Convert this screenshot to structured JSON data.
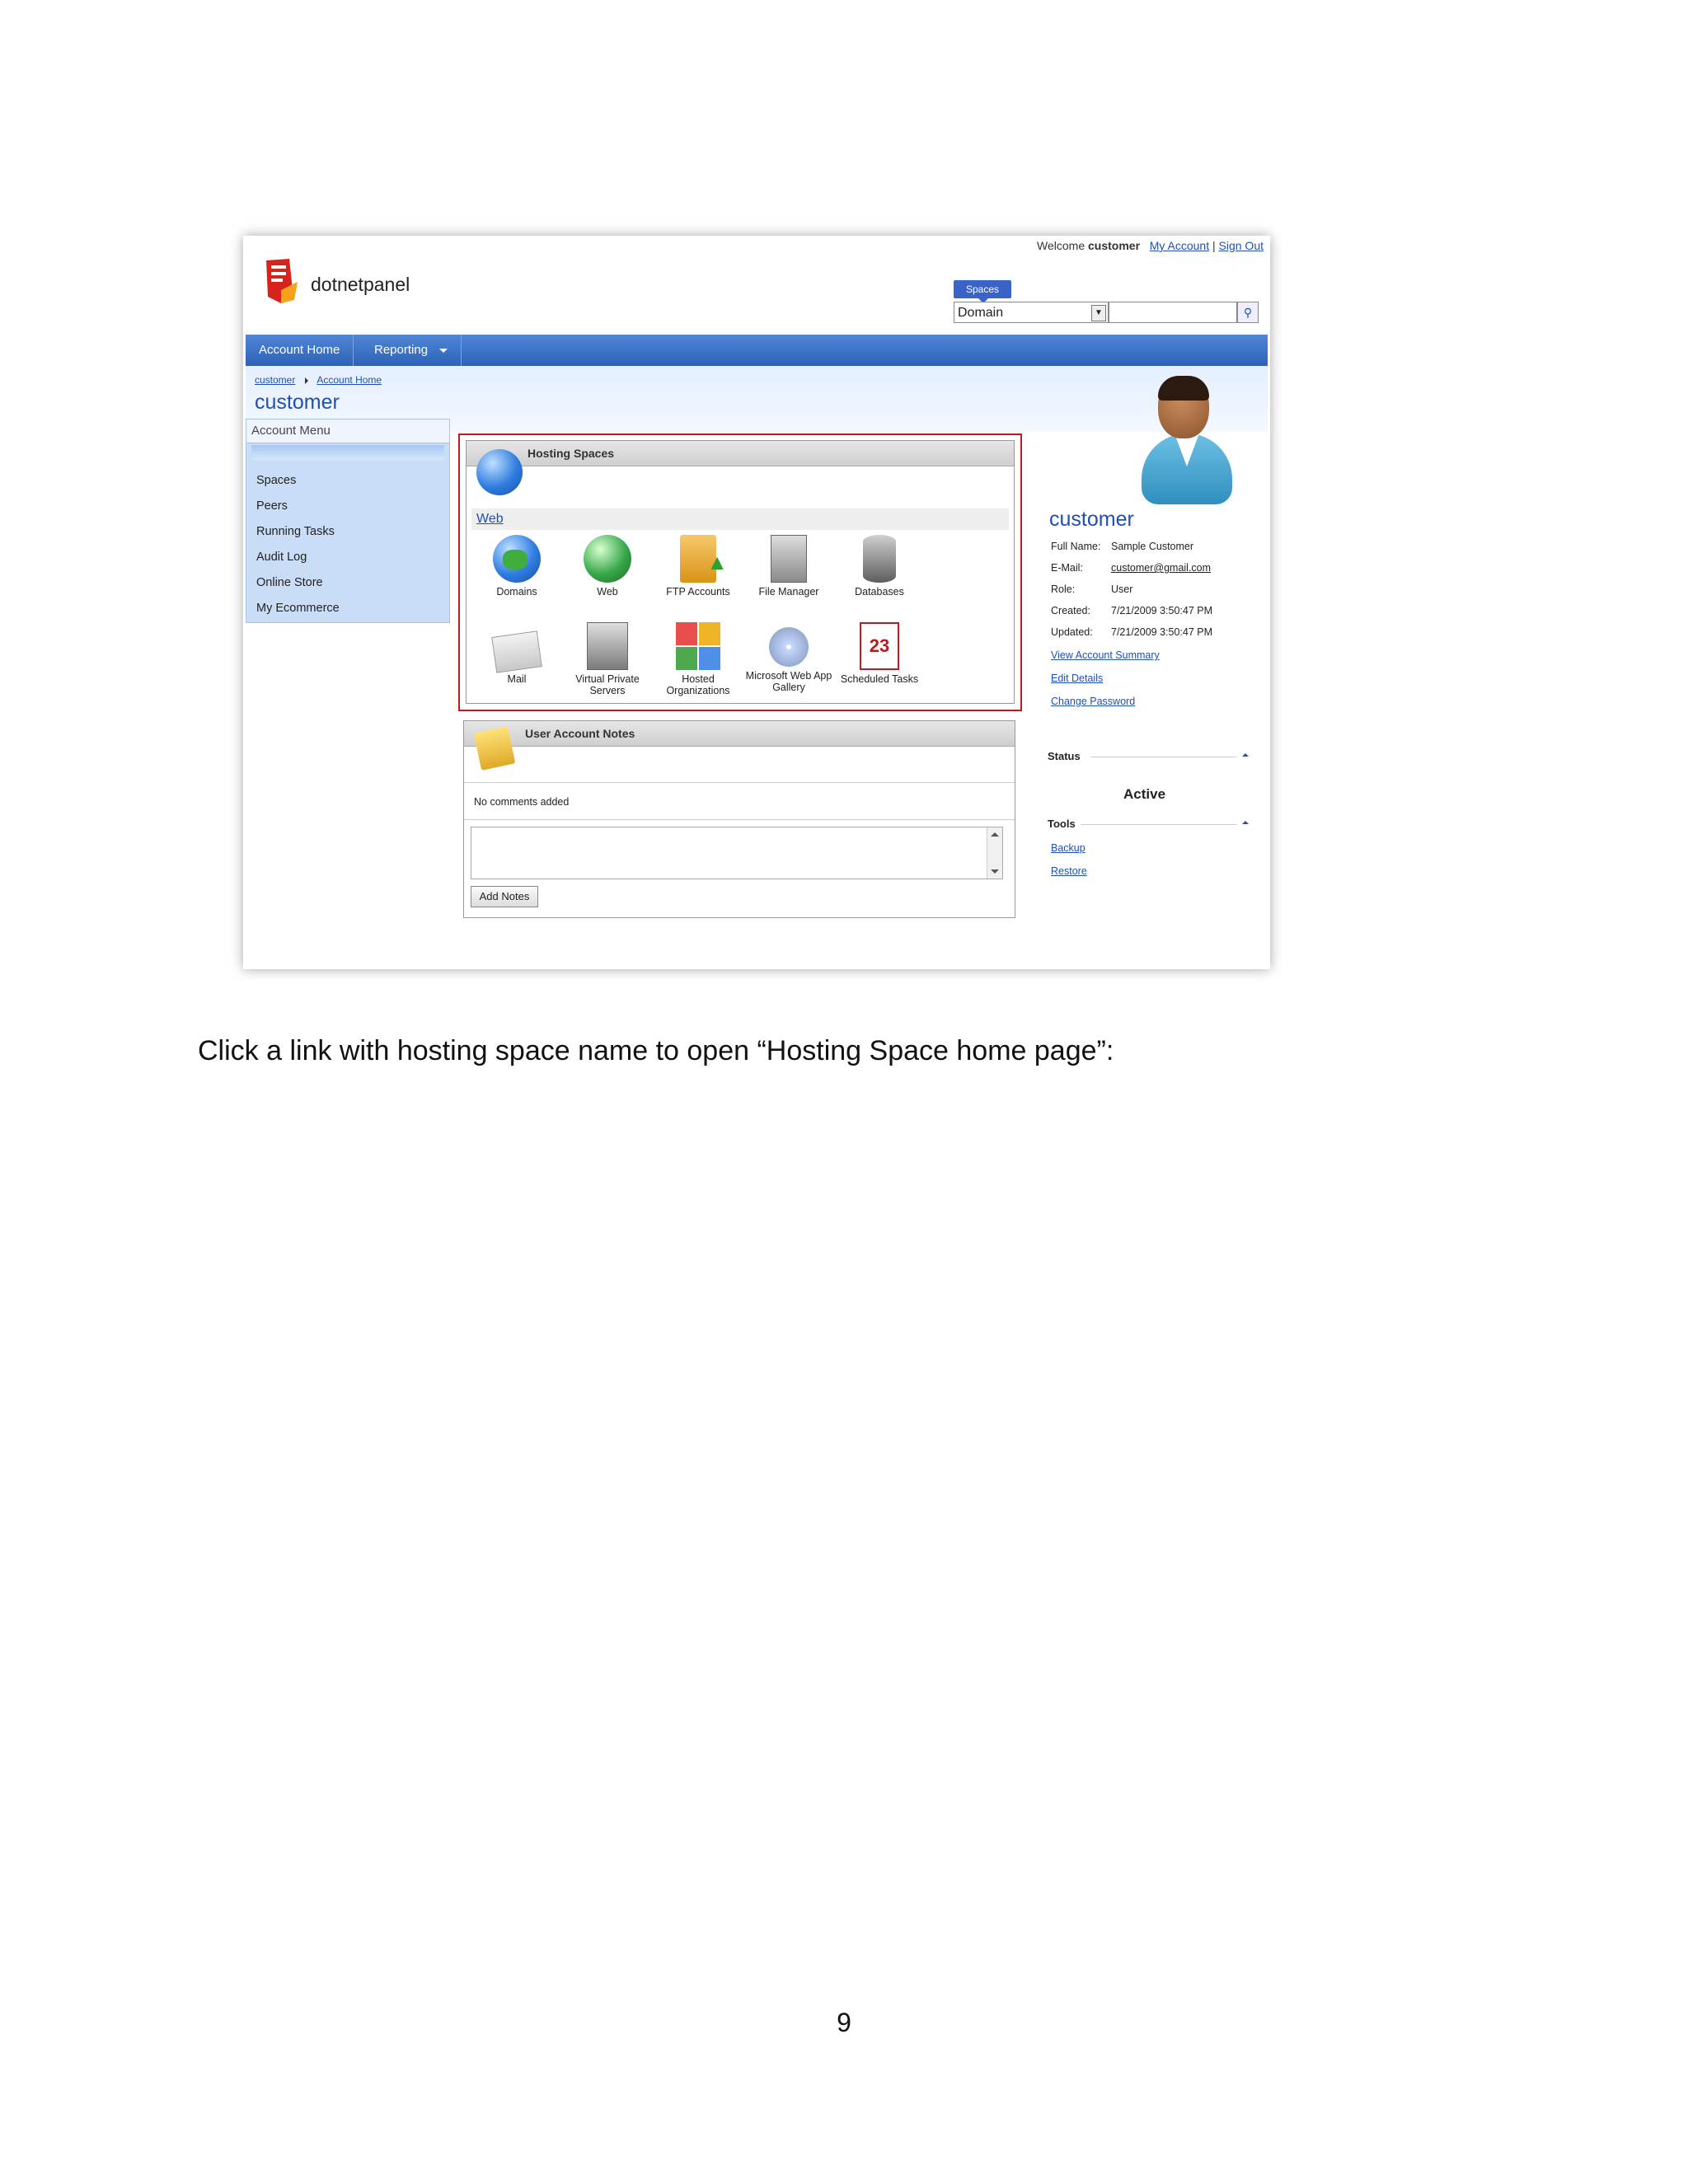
{
  "topbar": {
    "welcome": "Welcome",
    "user": "customer",
    "my_account": "My Account",
    "sep": "|",
    "sign_out": "Sign Out"
  },
  "brand": {
    "name": "dotnetpanel"
  },
  "search": {
    "badge": "Spaces",
    "selected": "Domain",
    "query": ""
  },
  "nav": {
    "items": [
      {
        "label": "Account Home"
      },
      {
        "label": "Reporting"
      }
    ]
  },
  "breadcrumb": {
    "items": [
      "customer",
      "Account Home"
    ]
  },
  "page_title": "customer",
  "account_menu": {
    "title": "Account Menu",
    "items": [
      "Spaces",
      "Peers",
      "Running Tasks",
      "Audit Log",
      "Online Store",
      "My Ecommerce"
    ]
  },
  "hosting_spaces": {
    "title": "Hosting Spaces",
    "space_link": "Web",
    "row1": [
      {
        "label": "Domains",
        "icon": "domains-icon"
      },
      {
        "label": "Web",
        "icon": "web-icon"
      },
      {
        "label": "FTP Accounts",
        "icon": "ftp-accounts-icon"
      },
      {
        "label": "File Manager",
        "icon": "file-manager-icon"
      },
      {
        "label": "Databases",
        "icon": "databases-icon"
      }
    ],
    "row2": [
      {
        "label": "Mail",
        "icon": "mail-icon"
      },
      {
        "label": "Virtual Private Servers",
        "icon": "vps-icon"
      },
      {
        "label": "Hosted Organizations",
        "icon": "hosted-organizations-icon"
      },
      {
        "label": "Microsoft Web App Gallery",
        "icon": "web-app-gallery-icon"
      },
      {
        "label": "Scheduled Tasks",
        "icon": "scheduled-tasks-icon"
      }
    ],
    "scheduled_icon_text": "23"
  },
  "notes": {
    "title": "User Account Notes",
    "empty_text": "No comments added",
    "add_label": "Add Notes"
  },
  "account": {
    "name": "customer",
    "full_name_label": "Full Name:",
    "full_name": "Sample Customer",
    "email_label": "E-Mail:",
    "email": "customer@gmail.com",
    "role_label": "Role:",
    "role": "User",
    "created_label": "Created:",
    "created": "7/21/2009 3:50:47 PM",
    "updated_label": "Updated:",
    "updated": "7/21/2009 3:50:47 PM",
    "links": [
      "View Account Summary",
      "Edit Details",
      "Change Password"
    ]
  },
  "status": {
    "title": "Status",
    "value": "Active"
  },
  "tools": {
    "title": "Tools",
    "links": [
      "Backup",
      "Restore"
    ]
  },
  "caption": "Click a link with hosting space name to open “Hosting Space home page”:",
  "page_number": "9",
  "colors": {
    "accent": "#1f4fb3",
    "nav": "#2c63b8",
    "highlight_border": "#c0181f"
  }
}
